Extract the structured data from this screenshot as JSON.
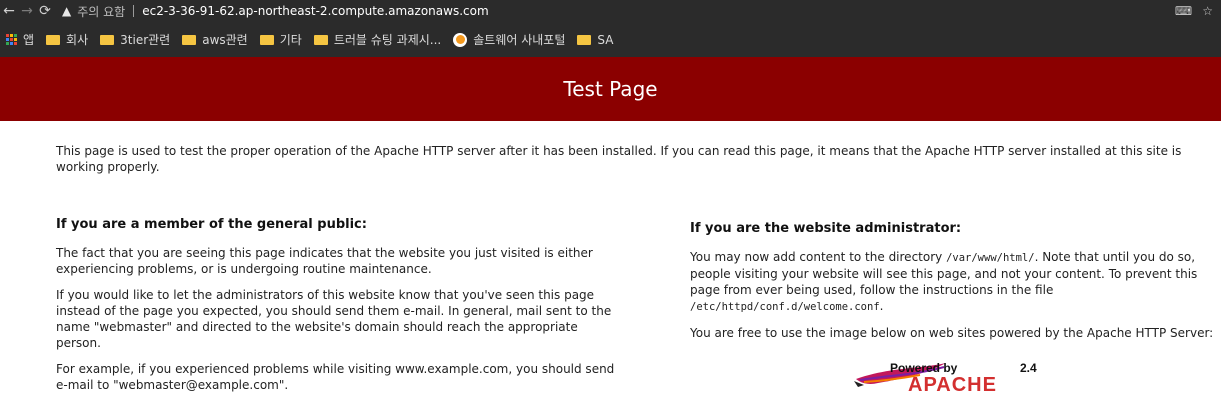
{
  "browser": {
    "address": {
      "warning_label": "주의 요함",
      "url": "ec2-3-36-91-62.ap-northeast-2.compute.amazonaws.com"
    }
  },
  "bookmarks": [
    {
      "label": "앱"
    },
    {
      "label": "회사"
    },
    {
      "label": "3tier관련"
    },
    {
      "label": "aws관련"
    },
    {
      "label": "기타"
    },
    {
      "label": "트러블 슈팅 과제시..."
    },
    {
      "label": "솔트웨어 사내포털"
    },
    {
      "label": "SA"
    }
  ],
  "page": {
    "title": "Test Page",
    "intro": "This page is used to test the proper operation of the Apache HTTP server after it has been installed. If you can read this page, it means that the Apache HTTP server installed at this site is working properly.",
    "public": {
      "heading": "If you are a member of the general public:",
      "p1": "The fact that you are seeing this page indicates that the website you just visited is either experiencing problems, or is undergoing routine maintenance.",
      "p2": "If you would like to let the administrators of this website know that you've seen this page instead of the page you expected, you should send them e-mail. In general, mail sent to the name \"webmaster\" and directed to the website's domain should reach the appropriate person.",
      "p3": "For example, if you experienced problems while visiting www.example.com, you should send e-mail to \"webmaster@example.com\"."
    },
    "admin": {
      "heading": "If you are the website administrator:",
      "p1_a": "You may now add content to the directory ",
      "p1_path": "/var/www/html/",
      "p1_b": ". Note that until you do so, people visiting your website will see this page, and not your content. To prevent this page from ever being used, follow the instructions in the file ",
      "p1_file": "/etc/httpd/conf.d/welcome.conf",
      "p1_c": ".",
      "p2": "You are free to use the image below on web sites powered by the Apache HTTP Server:",
      "badge": {
        "powered": "Powered by",
        "name": "APACHE",
        "version": "2.4"
      }
    }
  },
  "colors": {
    "banner": "#8b0000",
    "chrome": "#2b2b2b"
  }
}
